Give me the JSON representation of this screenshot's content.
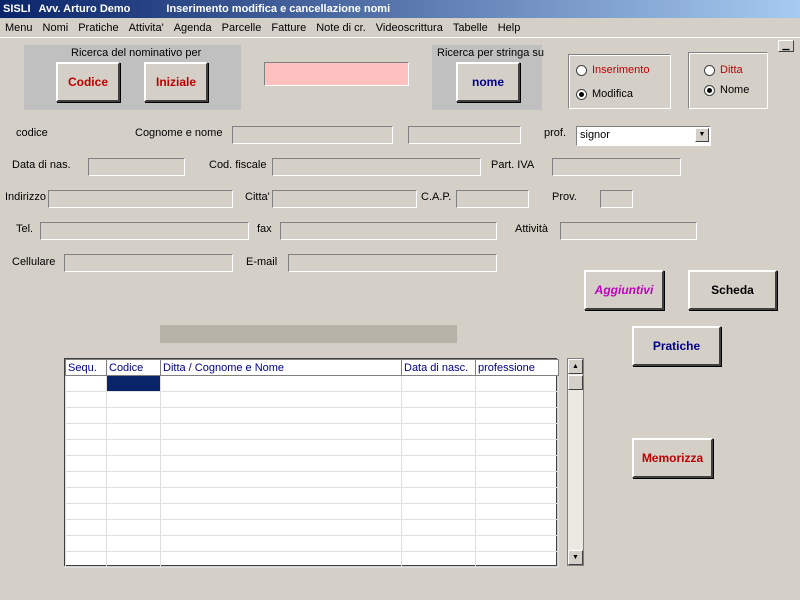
{
  "titlebar": {
    "app": "SISLI",
    "user": "Avv.  Arturo Demo",
    "window": "Inserimento modifica e cancellazione nomi"
  },
  "menu": [
    "Menu",
    "Nomi",
    "Pratiche",
    "Attivita'",
    "Agenda",
    "Parcelle",
    "Fatture",
    "Note di cr.",
    "Videoscrittura",
    "Tabelle",
    "Help"
  ],
  "search": {
    "group_label": "Ricerca del nominativo per",
    "codice": "Codice",
    "iniziale": "Iniziale",
    "string_label": "Ricerca per stringa su",
    "nome": "nome"
  },
  "mode": {
    "inserimento": "Inserimento",
    "modifica": "Modifica",
    "selected": "Modifica"
  },
  "type": {
    "ditta": "Ditta",
    "nome": "Nome",
    "selected": "Nome"
  },
  "form": {
    "codice": "codice",
    "cognome_nome": "Cognome e nome",
    "prof": "prof.",
    "prof_value": "signor",
    "data_nas": "Data di nas.",
    "cod_fiscale": "Cod. fiscale",
    "part_iva": "Part. IVA",
    "indirizzo": "Indirizzo",
    "citta": "Citta'",
    "cap": "C.A.P.",
    "prov": "Prov.",
    "tel": "Tel.",
    "fax": "fax",
    "attivita": "Attività",
    "cellulare": "Cellulare",
    "email": "E-mail"
  },
  "buttons": {
    "aggiuntivi": "Aggiuntivi",
    "scheda": "Scheda",
    "pratiche": "Pratiche",
    "memorizza": "Memorizza"
  },
  "grid": {
    "columns": [
      "Sequ.",
      "Codice",
      "Ditta / Cognome e Nome",
      "Data di nasc.",
      "professione"
    ],
    "row_count": 12
  },
  "colors": {
    "pink_field": "#ffc0c0",
    "title_start": "#0a246a",
    "selection": "#0a246a"
  }
}
